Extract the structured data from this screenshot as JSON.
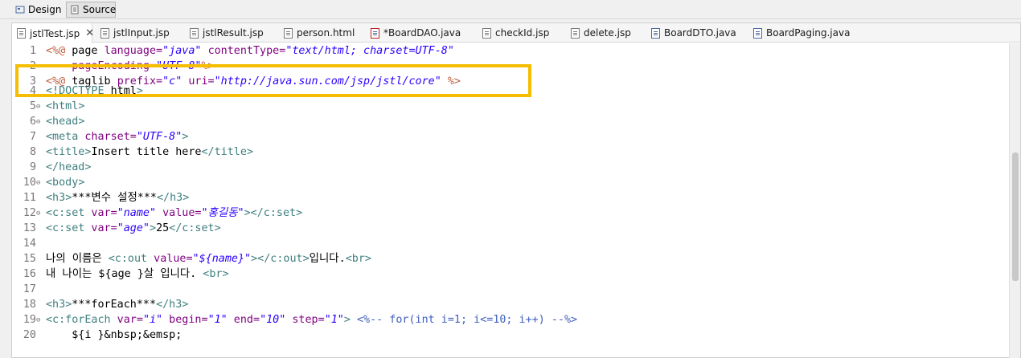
{
  "toolbar": {
    "design_label": "Design",
    "source_label": "Source"
  },
  "tabs": [
    {
      "label": "jstlTest.jsp",
      "active": true
    },
    {
      "label": "jstlInput.jsp"
    },
    {
      "label": "jstlResult.jsp"
    },
    {
      "label": "person.html"
    },
    {
      "label": "*BoardDAO.java"
    },
    {
      "label": "checkId.jsp"
    },
    {
      "label": "delete.jsp"
    },
    {
      "label": "BoardDTO.java"
    },
    {
      "label": "BoardPaging.java"
    }
  ],
  "code": {
    "line_numbers": [
      "1",
      "2",
      "3",
      "4",
      "5",
      "6",
      "7",
      "8",
      "9",
      "10",
      "11",
      "12",
      "13",
      "14",
      "15",
      "16",
      "17",
      "18",
      "19",
      "20"
    ],
    "lines": [
      "<%@ page language=\"java\" contentType=\"text/html; charset=UTF-8\"",
      "    pageEncoding=\"UTF-8\"%>",
      "<%@ taglib prefix=\"c\" uri=\"http://java.sun.com/jsp/jstl/core\" %>",
      "<!DOCTYPE html>",
      "<html>",
      "<head>",
      "<meta charset=\"UTF-8\">",
      "<title>Insert title here</title>",
      "</head>",
      "<body>",
      "<h3>***변수 설정***</h3>",
      "<c:set var=\"name\" value=\"홍길동\"></c:set>",
      "<c:set var=\"age\">25</c:set>",
      "",
      "나의 이름은 <c:out value=\"${name}\"></c:out>입니다.<br>",
      "내 나이는 ${age }살 입니다. <br>",
      "",
      "<h3>***forEach***</h3>",
      "<c:forEach var=\"i\" begin=\"1\" end=\"10\" step=\"1\"> <%-- for(int i=1; i<=10; i++) --%>",
      "    ${i }&nbsp;&emsp;"
    ]
  },
  "colors": {
    "highlight": "#f5be00",
    "tag": "#3f7f7f",
    "attribute": "#7f007f",
    "value": "#2a00ff"
  }
}
